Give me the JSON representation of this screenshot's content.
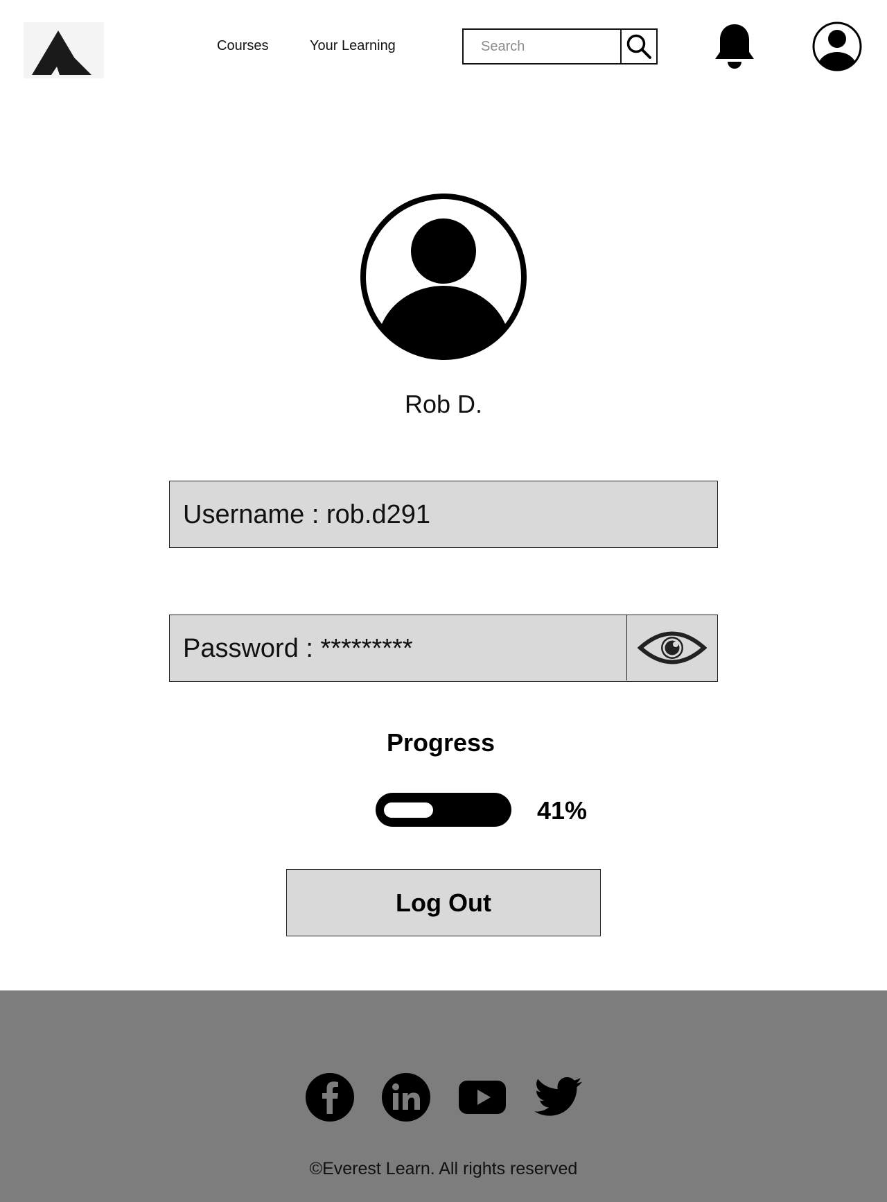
{
  "header": {
    "nav": {
      "courses": "Courses",
      "your_learning": "Your Learning"
    },
    "search": {
      "placeholder": "Search",
      "value": ""
    },
    "icons": {
      "logo": "mountain-logo",
      "search": "search-icon",
      "notifications": "bell-icon",
      "account": "user-avatar-icon"
    }
  },
  "profile": {
    "name": "Rob D.",
    "username": {
      "label": "Username : ",
      "value": "rob.d291"
    },
    "password": {
      "label": "Password : ",
      "value": "*********",
      "toggle_icon": "eye-icon"
    },
    "progress": {
      "title": "Progress",
      "value_text": "41%",
      "percent": 41
    },
    "logout_label": "Log Out"
  },
  "footer": {
    "social": [
      "facebook-icon",
      "linkedin-icon",
      "youtube-icon",
      "twitter-icon"
    ],
    "copyright": "©Everest Learn. All rights reserved"
  },
  "colors": {
    "field_bg": "#d9d9d9",
    "footer_bg": "#7d7d7d",
    "ink": "#000000"
  }
}
